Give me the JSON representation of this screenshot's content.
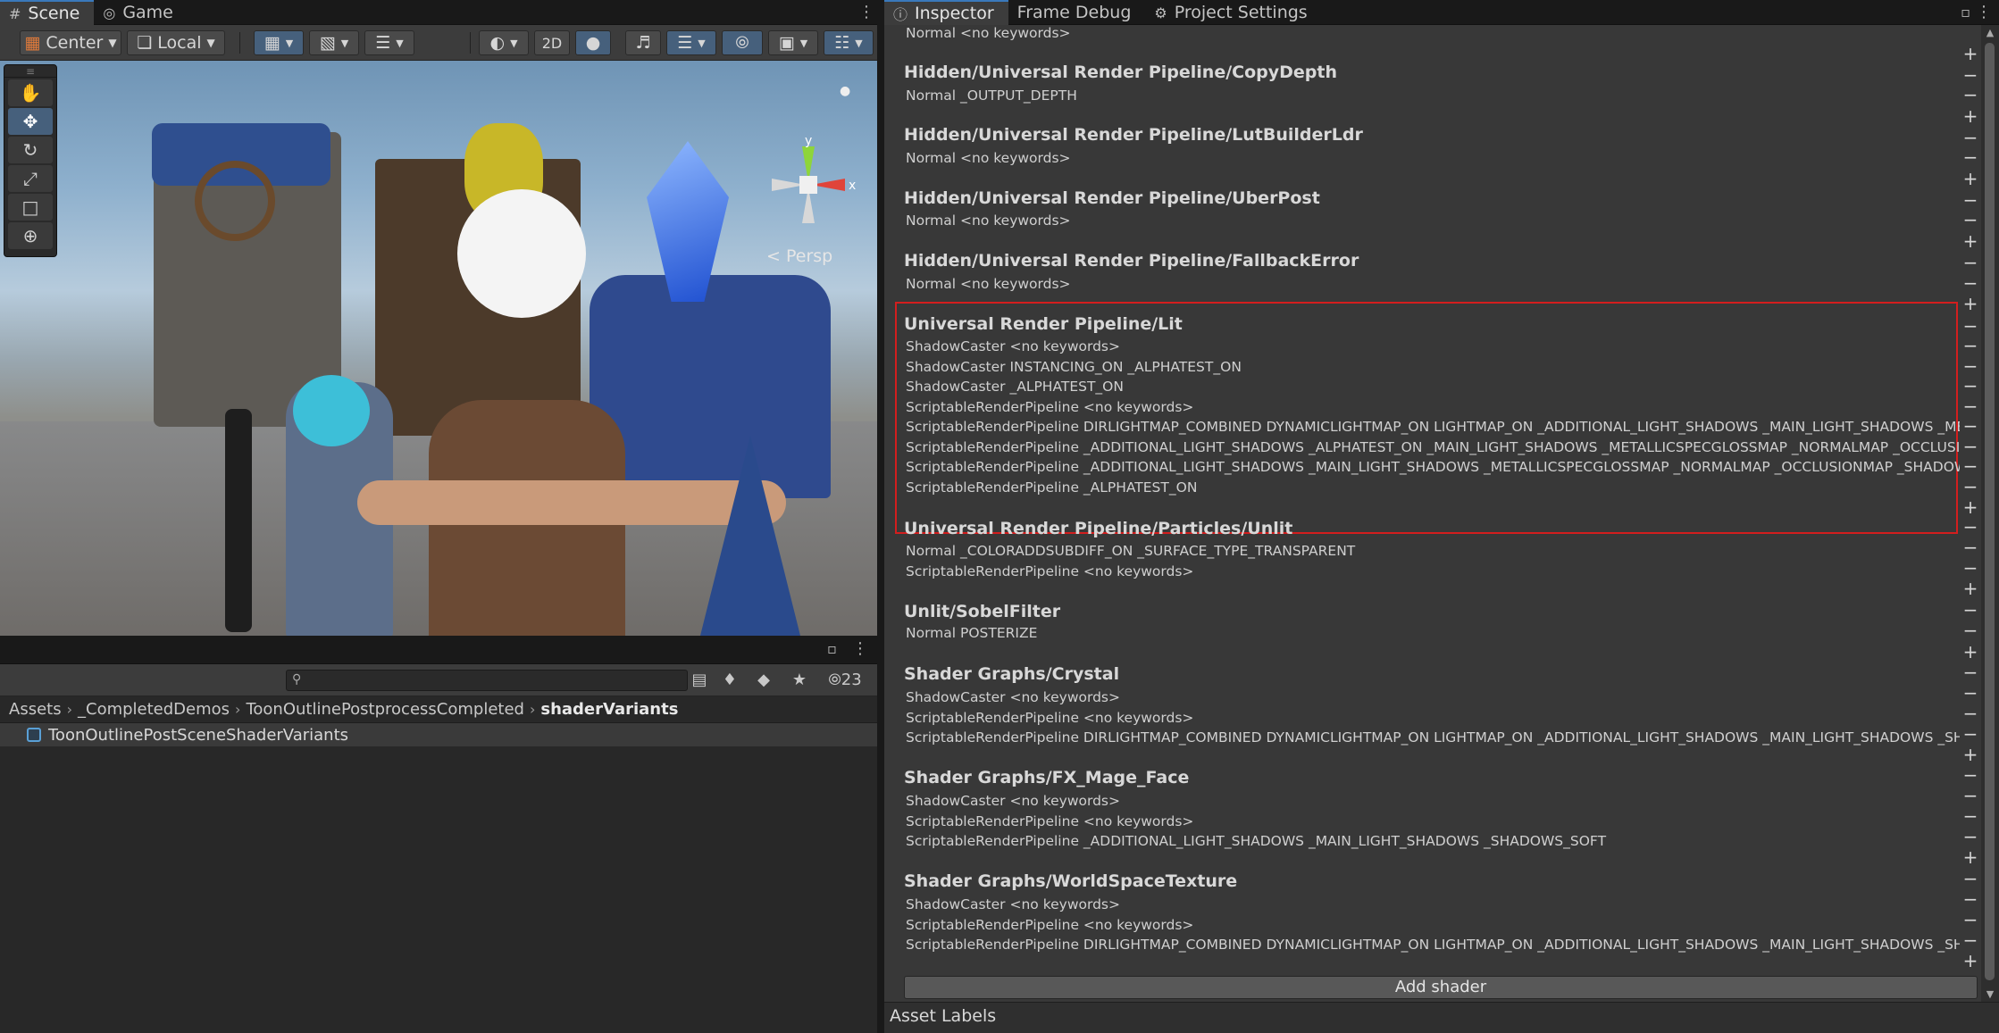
{
  "scene_tabs": [
    {
      "label": "Scene",
      "icon": "grid-icon"
    },
    {
      "label": "Game",
      "icon": "gamepad-icon"
    }
  ],
  "scene_toolbar": {
    "pivot_mode": "Center",
    "pivot_rotation": "Local",
    "view_2d": "2D"
  },
  "scene_view": {
    "persp_label": "Persp",
    "gizmo_axis_x": "x",
    "gizmo_axis_y": "y"
  },
  "project": {
    "hidden_count": "23",
    "search_placeholder": "",
    "breadcrumb": [
      "Assets",
      "_CompletedDemos",
      "ToonOutlinePostprocessCompleted",
      "shaderVariants"
    ],
    "asset": "ToonOutlinePostSceneShaderVariants"
  },
  "inspector_tabs": [
    {
      "label": "Inspector",
      "icon": "info-icon"
    },
    {
      "label": "Frame Debug",
      "icon": ""
    },
    {
      "label": "Project Settings",
      "icon": "gear-icon"
    }
  ],
  "shaders": {
    "top_line": "Normal <no keywords>",
    "copydepth": {
      "name": "Hidden/Universal Render Pipeline/CopyDepth",
      "variants": [
        "Normal _OUTPUT_DEPTH"
      ]
    },
    "lutbuilder": {
      "name": "Hidden/Universal Render Pipeline/LutBuilderLdr",
      "variants": [
        "Normal <no keywords>"
      ]
    },
    "uberpost": {
      "name": "Hidden/Universal Render Pipeline/UberPost",
      "variants": [
        "Normal <no keywords>"
      ]
    },
    "fallback": {
      "name": "Hidden/Universal Render Pipeline/FallbackError",
      "variants": [
        "Normal <no keywords>"
      ]
    },
    "lit": {
      "name": "Universal Render Pipeline/Lit",
      "variants": [
        "ShadowCaster <no keywords>",
        "ShadowCaster INSTANCING_ON _ALPHATEST_ON",
        "ShadowCaster _ALPHATEST_ON",
        "ScriptableRenderPipeline <no keywords>",
        "ScriptableRenderPipeline DIRLIGHTMAP_COMBINED DYNAMICLIGHTMAP_ON LIGHTMAP_ON _ADDITIONAL_LIGHT_SHADOWS _MAIN_LIGHT_SHADOWS _META",
        "ScriptableRenderPipeline _ADDITIONAL_LIGHT_SHADOWS _ALPHATEST_ON _MAIN_LIGHT_SHADOWS _METALLICSPECGLOSSMAP _NORMALMAP _OCCLUSION",
        "ScriptableRenderPipeline _ADDITIONAL_LIGHT_SHADOWS _MAIN_LIGHT_SHADOWS _METALLICSPECGLOSSMAP _NORMALMAP _OCCLUSIONMAP _SHADOWS_",
        "ScriptableRenderPipeline _ALPHATEST_ON"
      ]
    },
    "particles": {
      "name": "Universal Render Pipeline/Particles/Unlit",
      "variants": [
        "Normal _COLORADDSUBDIFF_ON _SURFACE_TYPE_TRANSPARENT",
        "ScriptableRenderPipeline <no keywords>"
      ]
    },
    "sobel": {
      "name": "Unlit/SobelFilter",
      "variants": [
        "Normal POSTERIZE"
      ]
    },
    "crystal": {
      "name": "Shader Graphs/Crystal",
      "variants": [
        "ShadowCaster <no keywords>",
        "ScriptableRenderPipeline <no keywords>",
        "ScriptableRenderPipeline DIRLIGHTMAP_COMBINED DYNAMICLIGHTMAP_ON LIGHTMAP_ON _ADDITIONAL_LIGHT_SHADOWS _MAIN_LIGHT_SHADOWS _SHA"
      ]
    },
    "mageface": {
      "name": "Shader Graphs/FX_Mage_Face",
      "variants": [
        "ShadowCaster <no keywords>",
        "ScriptableRenderPipeline <no keywords>",
        "ScriptableRenderPipeline _ADDITIONAL_LIGHT_SHADOWS _MAIN_LIGHT_SHADOWS _SHADOWS_SOFT"
      ]
    },
    "worldspace": {
      "name": "Shader Graphs/WorldSpaceTexture",
      "variants": [
        "ShadowCaster <no keywords>",
        "ScriptableRenderPipeline <no keywords>",
        "ScriptableRenderPipeline DIRLIGHTMAP_COMBINED DYNAMICLIGHTMAP_ON LIGHTMAP_ON _ADDITIONAL_LIGHT_SHADOWS _MAIN_LIGHT_SHADOWS _SHA"
      ]
    }
  },
  "add_shader_label": "Add shader",
  "asset_labels": "Asset Labels",
  "glyphs": {
    "plus": "+",
    "minus": "−",
    "menu": "⋮",
    "chevron": "›"
  },
  "colors": {
    "highlight": "#d31e1e",
    "active_tab": "#3a79bb",
    "panel_bg": "#383838"
  }
}
